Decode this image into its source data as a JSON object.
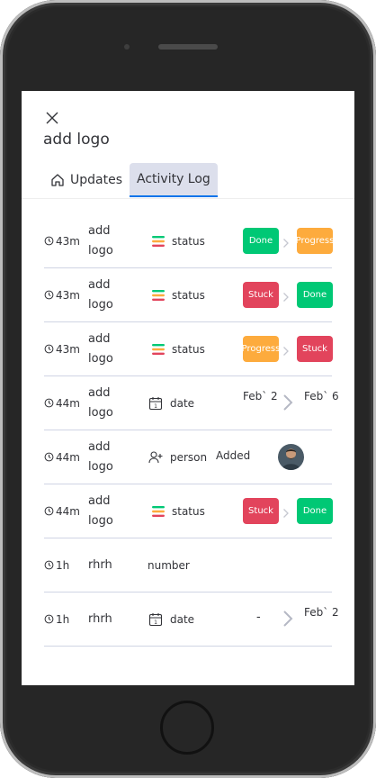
{
  "title": "add logo",
  "tabs": [
    {
      "label": "Updates",
      "icon": "home-icon"
    },
    {
      "label": "Activity Log"
    }
  ],
  "colors": {
    "done": "#00c875",
    "progress": "#fdab3d",
    "stuck": "#e2445c",
    "accent": "#0073ea"
  },
  "rows": [
    {
      "time": "43m",
      "item": "add logo",
      "column": "status",
      "kind": "status",
      "from": "Done",
      "to": "Progress"
    },
    {
      "time": "43m",
      "item": "add logo",
      "column": "status",
      "kind": "status",
      "from": "Stuck",
      "to": "Done"
    },
    {
      "time": "43m",
      "item": "add logo",
      "column": "status",
      "kind": "status",
      "from": "Progress",
      "to": "Stuck"
    },
    {
      "time": "44m",
      "item": "add logo",
      "column": "date",
      "kind": "date",
      "from": "Feb` 2",
      "to": "Feb` 6"
    },
    {
      "time": "44m",
      "item": "add logo",
      "column": "person",
      "kind": "person",
      "action": "Added"
    },
    {
      "time": "44m",
      "item": "add logo",
      "column": "status",
      "kind": "status",
      "from": "Stuck",
      "to": "Done"
    },
    {
      "time": "1h",
      "item": "rhrh",
      "column": "number",
      "kind": "number"
    },
    {
      "time": "1h",
      "item": "rhrh",
      "column": "date",
      "kind": "date",
      "from": "-",
      "to": "Feb` 2"
    }
  ]
}
